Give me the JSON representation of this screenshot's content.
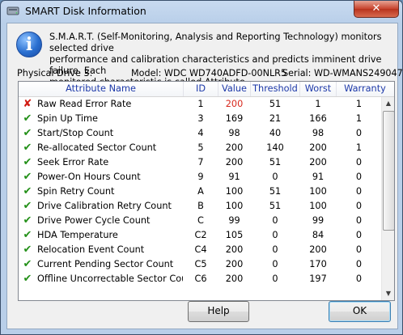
{
  "window": {
    "title": "SMART Disk Information",
    "close_glyph": "✕"
  },
  "info": {
    "icon": "info-icon",
    "lines": [
      "S.M.A.R.T. (Self-Monitoring, Analysis and Reporting Technology) monitors selected drive",
      "performance and calibration characteristics and predicts imminent drive failure. Each",
      "monitored characteristic is called Attribute."
    ]
  },
  "drive": {
    "physical": "Physical Drive 3:",
    "model": "Model: WDC WD740ADFD-00NLR5",
    "serial": "Serial: WD-WMANS2490477"
  },
  "columns": [
    "Attribute Name",
    "ID",
    "Value",
    "Threshold",
    "Worst",
    "Warranty"
  ],
  "rows": [
    {
      "status": "fail",
      "icon": "x-icon",
      "name": "Raw Read Error Rate",
      "id": "1",
      "value": "200",
      "threshold": "51",
      "worst": "1",
      "warranty": "1",
      "value_color": "#d8281d"
    },
    {
      "status": "ok",
      "icon": "check-icon",
      "name": "Spin Up Time",
      "id": "3",
      "value": "169",
      "threshold": "21",
      "worst": "166",
      "warranty": "1"
    },
    {
      "status": "ok",
      "icon": "check-icon",
      "name": "Start/Stop Count",
      "id": "4",
      "value": "98",
      "threshold": "40",
      "worst": "98",
      "warranty": "0"
    },
    {
      "status": "ok",
      "icon": "check-icon",
      "name": "Re-allocated Sector Count",
      "id": "5",
      "value": "200",
      "threshold": "140",
      "worst": "200",
      "warranty": "1"
    },
    {
      "status": "ok",
      "icon": "check-icon",
      "name": "Seek Error Rate",
      "id": "7",
      "value": "200",
      "threshold": "51",
      "worst": "200",
      "warranty": "0"
    },
    {
      "status": "ok",
      "icon": "check-icon",
      "name": "Power-On Hours Count",
      "id": "9",
      "value": "91",
      "threshold": "0",
      "worst": "91",
      "warranty": "0"
    },
    {
      "status": "ok",
      "icon": "check-icon",
      "name": "Spin Retry Count",
      "id": "A",
      "value": "100",
      "threshold": "51",
      "worst": "100",
      "warranty": "0"
    },
    {
      "status": "ok",
      "icon": "check-icon",
      "name": "Drive Calibration Retry Count",
      "id": "B",
      "value": "100",
      "threshold": "51",
      "worst": "100",
      "warranty": "0"
    },
    {
      "status": "ok",
      "icon": "check-icon",
      "name": "Drive Power Cycle Count",
      "id": "C",
      "value": "99",
      "threshold": "0",
      "worst": "99",
      "warranty": "0"
    },
    {
      "status": "ok",
      "icon": "check-icon",
      "name": "HDA Temperature",
      "id": "C2",
      "value": "105",
      "threshold": "0",
      "worst": "84",
      "warranty": "0"
    },
    {
      "status": "ok",
      "icon": "check-icon",
      "name": "Relocation Event Count",
      "id": "C4",
      "value": "200",
      "threshold": "0",
      "worst": "200",
      "warranty": "0"
    },
    {
      "status": "ok",
      "icon": "check-icon",
      "name": "Current Pending Sector Count",
      "id": "C5",
      "value": "200",
      "threshold": "0",
      "worst": "170",
      "warranty": "0"
    },
    {
      "status": "ok",
      "icon": "check-icon",
      "name": "Offline Uncorrectable Sector Count",
      "id": "C6",
      "value": "200",
      "threshold": "0",
      "worst": "197",
      "warranty": "0"
    }
  ],
  "buttons": {
    "help": "Help",
    "ok": "OK"
  },
  "colors": {
    "ok": "#239018",
    "fail": "#d11b12",
    "header_text": "#1c38a8",
    "chrome": "#b9cfe9"
  }
}
